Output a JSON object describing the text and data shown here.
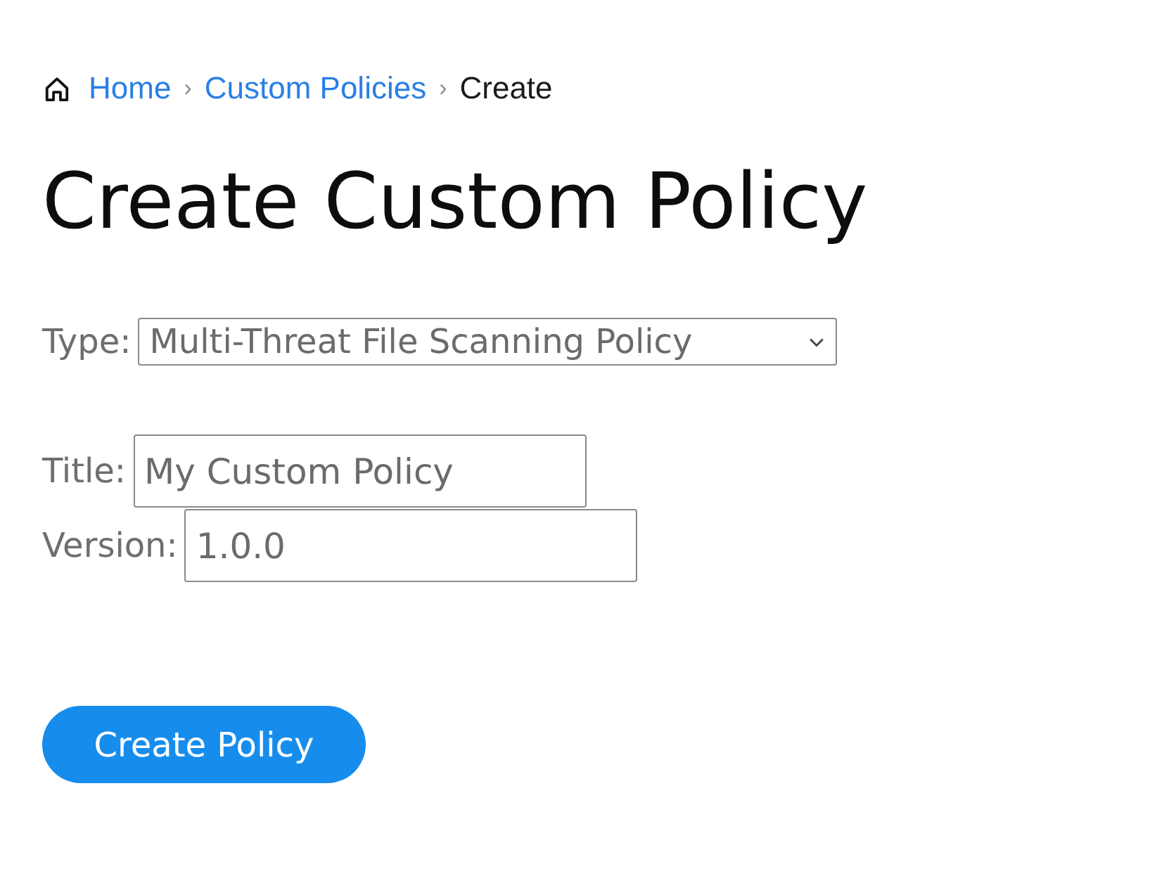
{
  "breadcrumb": [
    {
      "label": "Home",
      "kind": "link"
    },
    {
      "label": "Custom Policies",
      "kind": "link",
      "separator": "›"
    },
    {
      "label": "Create",
      "kind": "current",
      "separator": "›"
    }
  ],
  "heading": "Create Custom Policy",
  "fields": [
    {
      "kind": "select",
      "label": "Type:",
      "value": "Multi-Threat File Scanning Policy"
    },
    {
      "kind": "text",
      "label": "Title:",
      "value": "My Custom Policy"
    },
    {
      "kind": "text",
      "label": "Version:",
      "value": "1.0.0"
    }
  ],
  "button": {
    "label": "Create Policy"
  }
}
